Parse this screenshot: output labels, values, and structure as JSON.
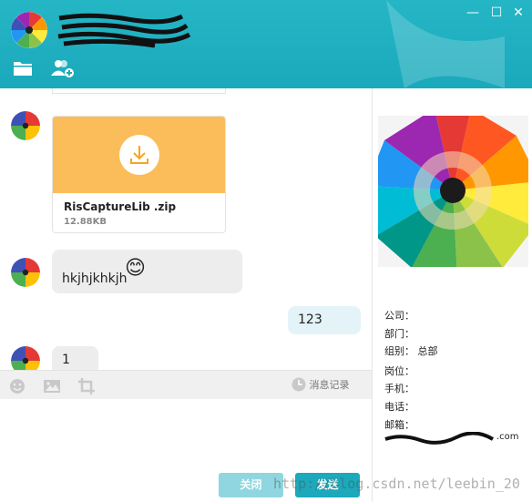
{
  "window": {
    "minimize_glyph": "—",
    "maximize_glyph": "☐",
    "close_glyph": "✕"
  },
  "header": {
    "contact_name_obscured": true
  },
  "toolbar_top": {
    "icons": [
      "folder-icon",
      "add-user-icon"
    ]
  },
  "messages": [
    {
      "side": "left",
      "kind": "file",
      "file_name": "RisCaptureLib .zip",
      "file_size": "12.88KB"
    },
    {
      "side": "left",
      "kind": "text",
      "text": "hkjhjkhkjh",
      "emoji": "😊"
    },
    {
      "side": "right",
      "kind": "text",
      "text": "123"
    },
    {
      "side": "left",
      "kind": "text",
      "text": "1"
    }
  ],
  "input_toolbar": {
    "icons": [
      "smile-icon",
      "image-icon",
      "screenshot-icon"
    ],
    "history_label": "消息记录"
  },
  "buttons": {
    "close_label": "关闭",
    "send_label": "发送"
  },
  "profile": {
    "company_label": "公司：",
    "department_label": "部门：",
    "group_label": "组别：",
    "group_value": "总部",
    "position_label": "岗位：",
    "mobile_label": "手机：",
    "phone_label": "电话：",
    "email_label": "邮箱：",
    "email_suffix": ".com"
  },
  "watermark": "http://blog.csdn.net/leebin_20",
  "colors": {
    "header": "#1aa9bb",
    "file_card": "#fbbd5a",
    "send_button": "#1ba9bb"
  }
}
